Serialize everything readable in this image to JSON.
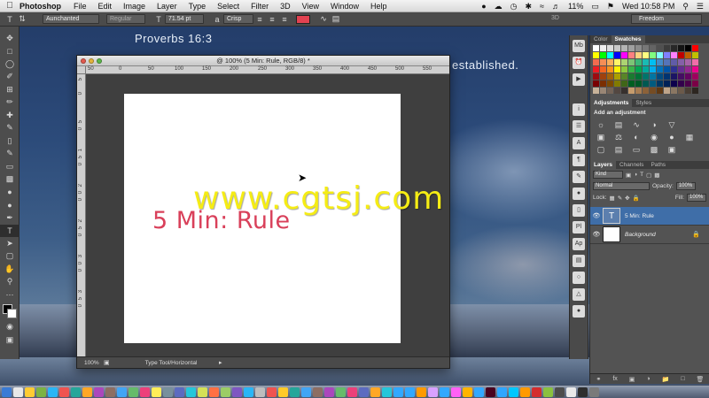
{
  "menubar": {
    "app_name": "Photoshop",
    "menus": [
      "File",
      "Edit",
      "Image",
      "Layer",
      "Type",
      "Select",
      "Filter",
      "3D",
      "View",
      "Window",
      "Help"
    ],
    "battery": "11%",
    "clock": "Wed 10:58 PM"
  },
  "options": {
    "font_family": "Aunchanted",
    "font_style": "Regular",
    "font_size": "71.54 pt",
    "antialias": "Crisp",
    "three_d": "3D",
    "workspace": "Freedom",
    "text_color": "#e24251"
  },
  "desktop": {
    "quote_ref": "Proverbs 16:3",
    "quote_tail": "established."
  },
  "document": {
    "title": "@ 100% (5 Min: Rule, RGB/8) *",
    "ruler_h": [
      "50",
      "0",
      "50",
      "100",
      "150",
      "200",
      "250",
      "300",
      "350",
      "400",
      "450",
      "500",
      "550"
    ],
    "ruler_v": [
      "5",
      "0",
      "5",
      "0",
      "1",
      "5",
      "0",
      "2",
      "0",
      "0",
      "2",
      "5",
      "0",
      "3",
      "0",
      "0",
      "3",
      "5",
      "0"
    ],
    "canvas_text": "5 Min: Rule",
    "zoom": "100%",
    "status_info": "Type Tool/Horizontal"
  },
  "watermark": "www.cgtsj.com",
  "panels": {
    "color_tabs": [
      "Color",
      "Swatches"
    ],
    "adjust_tabs": [
      "Adjustments",
      "Styles"
    ],
    "adjust_title": "Add an adjustment",
    "layers_tabs": [
      "Layers",
      "Channels",
      "Paths"
    ],
    "kind_label": "Kind",
    "blend_mode": "Normal",
    "opacity_label": "Opacity:",
    "opacity_value": "100%",
    "lock_label": "Lock:",
    "fill_label": "Fill:",
    "fill_value": "100%",
    "layers": [
      {
        "name": "5 Min: Rule",
        "type": "text",
        "selected": true
      },
      {
        "name": "Background",
        "type": "image",
        "selected": false
      }
    ]
  },
  "swatch_colors": [
    "#ffffff",
    "#eeeeee",
    "#dcdcdc",
    "#c8c8c8",
    "#b4b4b4",
    "#a0a0a0",
    "#8c8c8c",
    "#787878",
    "#646464",
    "#505050",
    "#3c3c3c",
    "#282828",
    "#141414",
    "#000000",
    "#ff0000",
    "#ffff00",
    "#00ff00",
    "#00ffff",
    "#0000ff",
    "#ff00ff",
    "#ff8080",
    "#ffd280",
    "#ffff80",
    "#80ff80",
    "#80ffff",
    "#8080ff",
    "#ff80ff",
    "#c00000",
    "#c06000",
    "#c0c000",
    "#f26c4f",
    "#f68e55",
    "#fbaf5c",
    "#fff467",
    "#acd372",
    "#7cc576",
    "#3bb878",
    "#1abbb4",
    "#00bff3",
    "#438cca",
    "#5574b9",
    "#605ca8",
    "#855fa8",
    "#a763a8",
    "#f06ea9",
    "#ed1c24",
    "#f26522",
    "#f7941d",
    "#fff200",
    "#8dc73f",
    "#39b54a",
    "#00a651",
    "#00a99d",
    "#00aeef",
    "#0072bc",
    "#0054a6",
    "#2e3192",
    "#662d91",
    "#92278f",
    "#ec008c",
    "#9e0b0f",
    "#a0410d",
    "#a3620a",
    "#aba000",
    "#598527",
    "#197b30",
    "#007236",
    "#00746b",
    "#0076a3",
    "#004b80",
    "#003471",
    "#1b1464",
    "#440e62",
    "#630460",
    "#9e005d",
    "#790000",
    "#7b2e00",
    "#7d4900",
    "#827b00",
    "#406618",
    "#005e20",
    "#005826",
    "#005952",
    "#005b7f",
    "#003663",
    "#002157",
    "#0d004c",
    "#32004b",
    "#4b0049",
    "#7b0046",
    "#c7b299",
    "#998675",
    "#736357",
    "#534741",
    "#37302d",
    "#c69c6d",
    "#a67c52",
    "#8c6239",
    "#754c24",
    "#603913",
    "#bfa58a",
    "#8a7763",
    "#6b5a4a",
    "#4a3f35",
    "#2d2620"
  ],
  "dock_colors": [
    "#3a7bd5",
    "#e8e8e8",
    "#ffcc33",
    "#7cb342",
    "#29b6f6",
    "#ef5350",
    "#26a69a",
    "#ffa726",
    "#ab47bc",
    "#8d6e63",
    "#42a5f5",
    "#66bb6a",
    "#ec407a",
    "#ffee58",
    "#78909c",
    "#5c6bc0",
    "#26c6da",
    "#d4e157",
    "#ff7043",
    "#9ccc65",
    "#7e57c2",
    "#29b6f6",
    "#bdbdbd",
    "#ef5350",
    "#ffca28",
    "#26a69a",
    "#42a5f5",
    "#8d6e63",
    "#ab47bc",
    "#66bb6a",
    "#ec407a",
    "#5c6bc0",
    "#ffa726",
    "#26c6da",
    "#31a8ff",
    "#31a8ff",
    "#ff9a00",
    "#d9a1ff",
    "#31a8ff",
    "#ff61f6",
    "#ffb400",
    "#31a8ff",
    "#49021f",
    "#2fa6ff",
    "#00c8ff",
    "#ff9a00",
    "#d42d2d",
    "#8ac13f",
    "#4c4c4c",
    "#e9e9e9",
    "#2d2d2d",
    "#7a7a7a"
  ]
}
